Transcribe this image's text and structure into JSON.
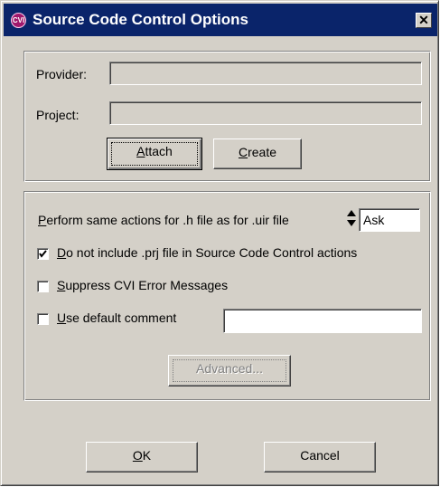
{
  "window": {
    "title": "Source Code Control Options",
    "app_icon": "CVI",
    "close_glyph": "✕"
  },
  "provider": {
    "label": "Provider:",
    "value": ""
  },
  "project": {
    "label": "Project:",
    "value": ""
  },
  "buttons": {
    "attach": {
      "first": "A",
      "rest": "ttach"
    },
    "create": {
      "first": "C",
      "rest": "reate"
    },
    "advanced": "Advanced...",
    "ok": {
      "first": "O",
      "rest": "K"
    },
    "cancel": "Cancel"
  },
  "options": {
    "perform": {
      "first": "P",
      "rest": "erform same actions for .h file as for .uir file",
      "value": "Ask"
    },
    "no_prj": {
      "first": "D",
      "rest": "o not include .prj file in Source Code Control actions",
      "checked": true
    },
    "suppress": {
      "first": "S",
      "rest": "uppress CVI Error Messages",
      "checked": false
    },
    "default_comment": {
      "first": "U",
      "rest": "se default comment",
      "checked": false,
      "value": ""
    }
  },
  "colors": {
    "title_bar": "#0a246a",
    "face": "#d4d0c8"
  }
}
